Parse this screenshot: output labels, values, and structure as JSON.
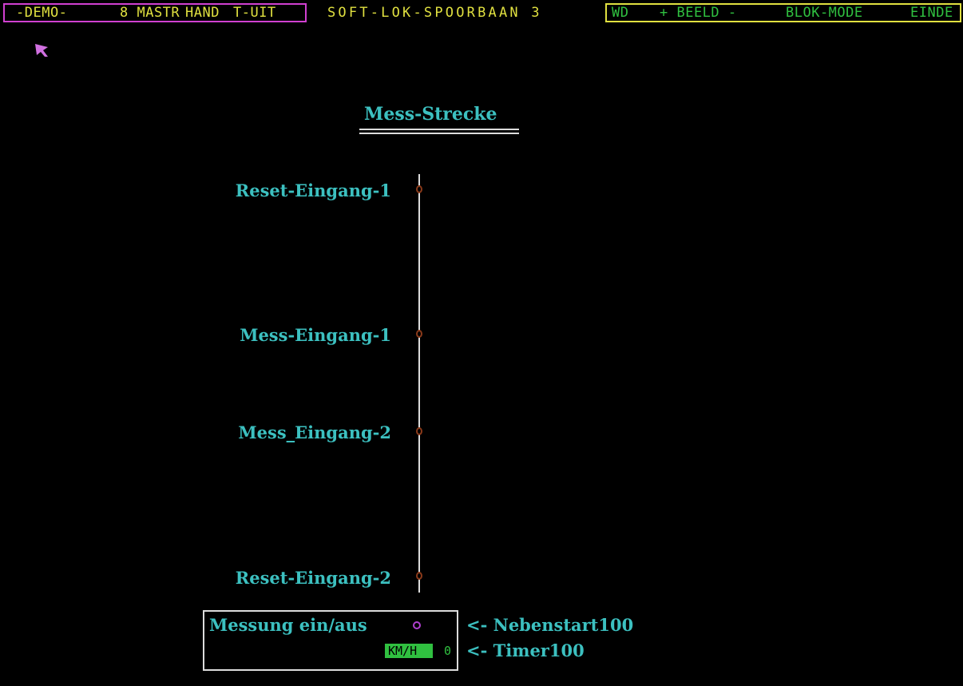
{
  "menubar": {
    "demo": "-DEMO-",
    "left_items": [
      "8 MASTR",
      "HAND",
      "T-UIT"
    ],
    "app_title": "SOFT-LOK-SPOORBAAN 3",
    "right_items": [
      "WD",
      "+ BEELD -",
      "BLOK-MODE",
      "EINDE"
    ]
  },
  "main": {
    "title": "Mess-Strecke",
    "sensors": [
      {
        "label": "Reset-Eingang-1"
      },
      {
        "label": "Mess-Eingang-1"
      },
      {
        "label": "Mess_Eingang-2"
      },
      {
        "label": "Reset-Eingang-2"
      }
    ],
    "measure": {
      "label": "Messung ein/aus",
      "unit": "KM/H",
      "value": "0",
      "link1": "<- Nebenstart100",
      "link2": "<- Timer100"
    }
  },
  "colors": {
    "cyan": "#3cc0c0",
    "green": "#30c040",
    "yellow": "#e0e040",
    "magenta": "#d040d0",
    "rail": "#dcdcdc",
    "sensor": "#8b3a1a"
  }
}
